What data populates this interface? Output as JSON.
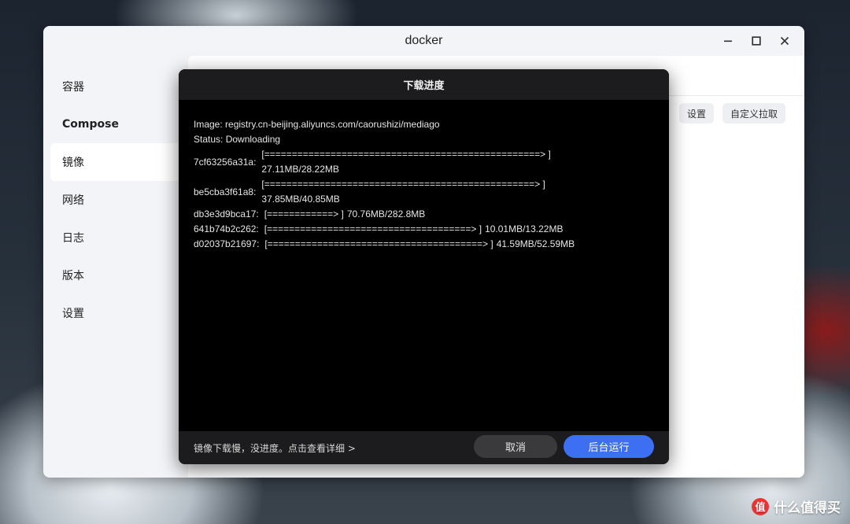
{
  "window": {
    "title": "docker"
  },
  "sidebar": {
    "items": [
      {
        "label": "容器"
      },
      {
        "label": "Compose"
      },
      {
        "label": "镜像"
      },
      {
        "label": "网络"
      },
      {
        "label": "日志"
      },
      {
        "label": "版本"
      },
      {
        "label": "设置"
      }
    ],
    "active": "镜像"
  },
  "content": {
    "settings_btn": "设置",
    "custom_pull_btn": "自定义拉取"
  },
  "modal": {
    "title": "下载进度",
    "image_line": "Image: registry.cn-beijing.aliyuncs.com/caorushizi/mediago",
    "status_line": "Status: Downloading",
    "layers": [
      {
        "id": "7cf63256a31a:",
        "bar": "[==================================================>   ]",
        "size": "27.11MB/28.22MB"
      },
      {
        "id": "be5cba3f61a8:",
        "bar": "[=================================================>    ]",
        "size": "37.85MB/40.85MB"
      },
      {
        "id": "db3e3d9bca17:",
        "bar": "[============>                ]",
        "size": "70.76MB/282.8MB"
      },
      {
        "id": "641b74b2c262:",
        "bar": "[=====================================>         ]",
        "size": "10.01MB/13.22MB"
      },
      {
        "id": "d02037b21697:",
        "bar": "[=======================================>          ]",
        "size": "41.59MB/52.59MB"
      }
    ],
    "footer_note": "镜像下载慢，没进度。点击查看详细 >",
    "cancel_label": "取消",
    "background_label": "后台运行"
  },
  "watermark": {
    "badge": "值",
    "text": "什么值得买"
  },
  "colors": {
    "accent": "#3d6ff2",
    "modal_bg": "#000000",
    "modal_bar": "#1c1c1e"
  }
}
